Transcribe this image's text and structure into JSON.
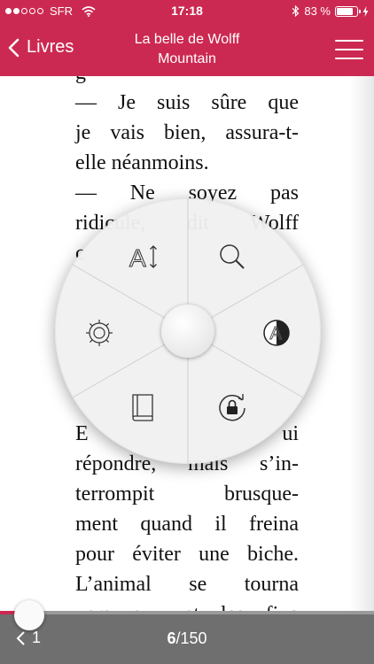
{
  "status_bar": {
    "carrier": "SFR",
    "time": "17:18",
    "battery": "83 %",
    "battery_level": 0.83,
    "signal_bars_filled": 2
  },
  "header": {
    "back_label": "Livres",
    "title_line1": "La belle de Wolff",
    "title_line2": "Mountain"
  },
  "page_text": [
    "g",
    "— Je suis sûre que",
    "je vais bien, assura-t-",
    "elle néanmoins.",
    "— Ne   soyez   pas",
    "ridicule,   dit   Wolff",
    "c",
    "",
    "",
    "",
    "",
    "",
    "E                              ui",
    "répondre, mais s’in-",
    "terrompit   brusque-",
    "ment quand il freina",
    "pour éviter une biche.",
    "L’animal  se  tourna",
    "vers  eux  et  les  fixa"
  ],
  "radial_menu": {
    "items": [
      "font-size-icon",
      "search-icon",
      "settings-gear-icon",
      "contrast-theme-icon",
      "book-icon",
      "rotation-lock-icon"
    ],
    "font_icon_letter": "A",
    "contrast_icon_letter": "A"
  },
  "bottom_bar": {
    "prev_label": "1",
    "current_page": "6",
    "total_pages": "/150",
    "progress": 0.04
  },
  "colors": {
    "accent": "#cc2952",
    "bottom_bar": "#6f6f6f"
  }
}
